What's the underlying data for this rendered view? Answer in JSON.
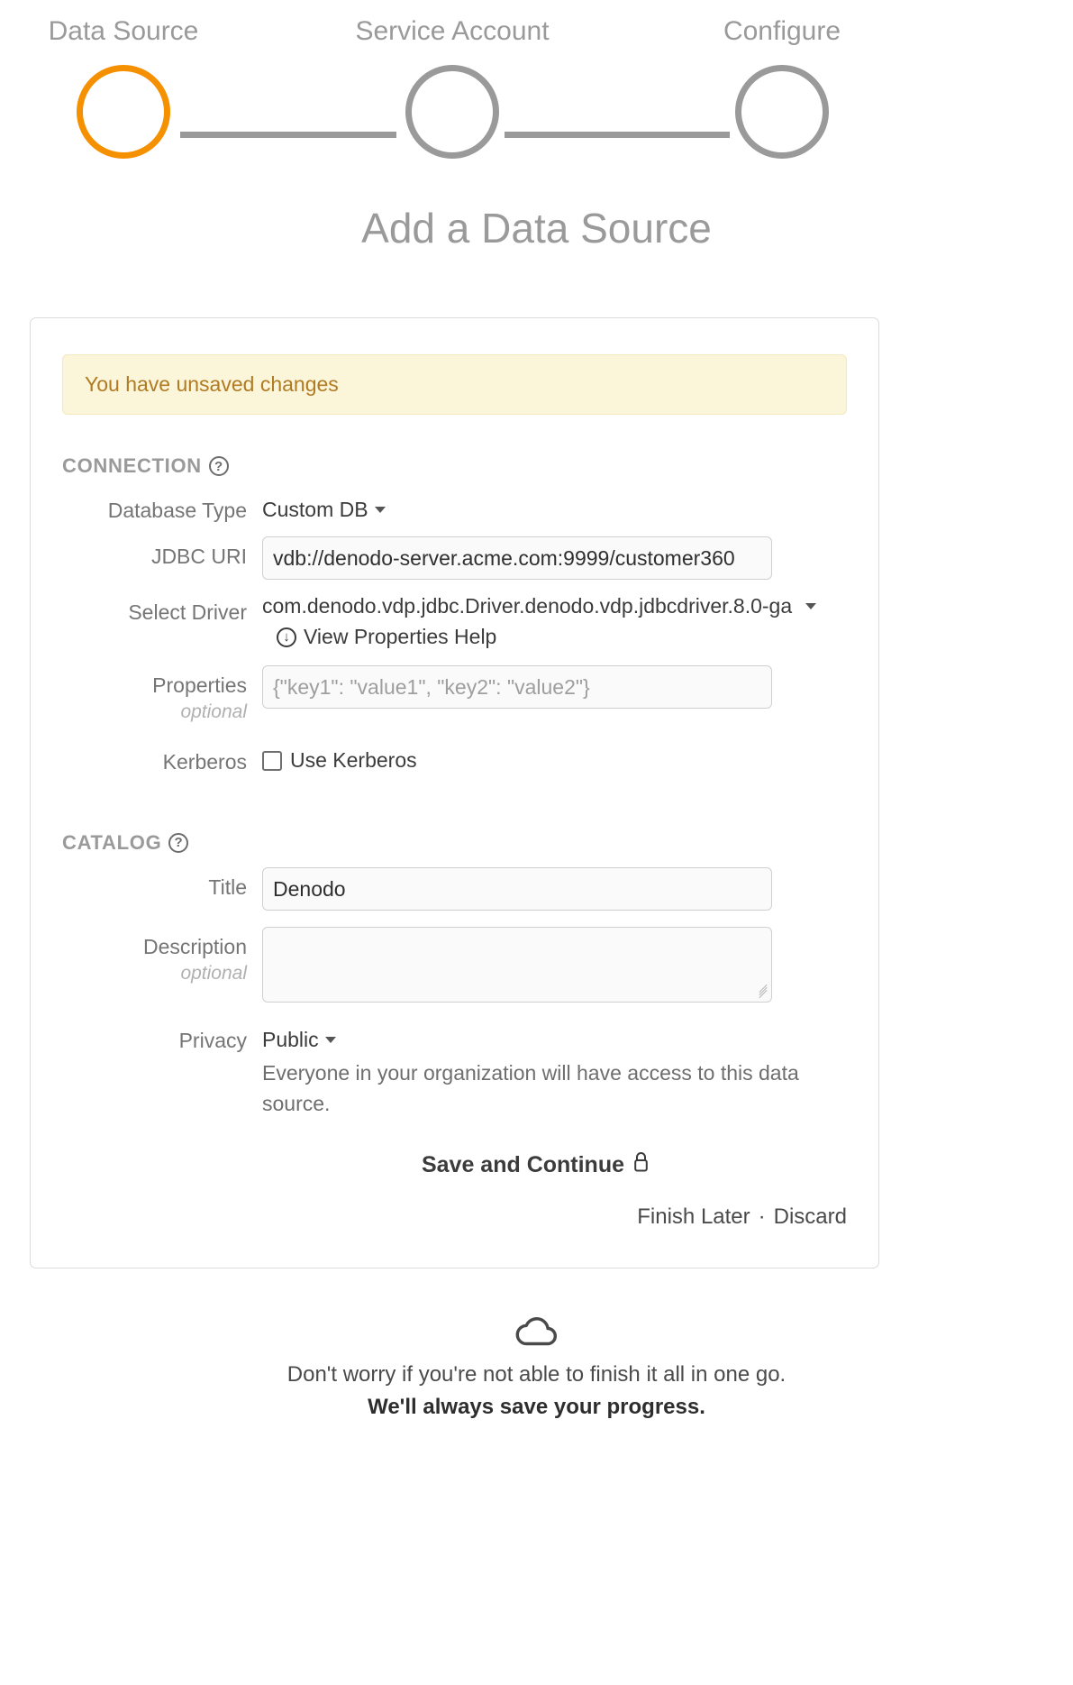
{
  "wizard": {
    "steps": [
      {
        "label": "Data Source",
        "state": "active"
      },
      {
        "label": "Service Account",
        "state": "inactive"
      },
      {
        "label": "Configure",
        "state": "inactive"
      }
    ],
    "active_color": "#f59000",
    "inactive_color": "#9a9a9a"
  },
  "page_title": "Add a Data Source",
  "banner": {
    "text": "You have unsaved changes",
    "background": "#fbf5d9",
    "text_color": "#b07b23"
  },
  "connection": {
    "heading": "CONNECTION",
    "help_icon": "question-circle-icon",
    "database_type": {
      "label": "Database Type",
      "value": "Custom DB"
    },
    "jdbc_uri": {
      "label": "JDBC URI",
      "value": "vdb://denodo-server.acme.com:9999/customer360"
    },
    "select_driver": {
      "label": "Select Driver",
      "value": "com.denodo.vdp.jdbc.Driver.denodo.vdp.jdbcdriver.8.0-ga"
    },
    "properties_help_link": {
      "label": "View Properties Help",
      "icon": "download-circle-icon"
    },
    "properties": {
      "label": "Properties",
      "optional": "optional",
      "placeholder": "{\"key1\": \"value1\", \"key2\": \"value2\"}",
      "value": ""
    },
    "kerberos": {
      "label": "Kerberos",
      "checkbox_label": "Use Kerberos",
      "checked": false
    }
  },
  "catalog": {
    "heading": "CATALOG",
    "help_icon": "question-circle-icon",
    "title": {
      "label": "Title",
      "value": "Denodo"
    },
    "description": {
      "label": "Description",
      "optional": "optional",
      "value": ""
    },
    "privacy": {
      "label": "Privacy",
      "value": "Public",
      "description": "Everyone in your organization will have access to this data source."
    }
  },
  "actions": {
    "save_label": "Save and Continue",
    "save_icon": "lock-icon",
    "finish_later": "Finish Later",
    "separator": "·",
    "discard": "Discard"
  },
  "footer": {
    "icon": "cloud-icon",
    "line1": "Don't worry if you're not able to finish it all in one go.",
    "line2": "We'll always save your progress."
  }
}
